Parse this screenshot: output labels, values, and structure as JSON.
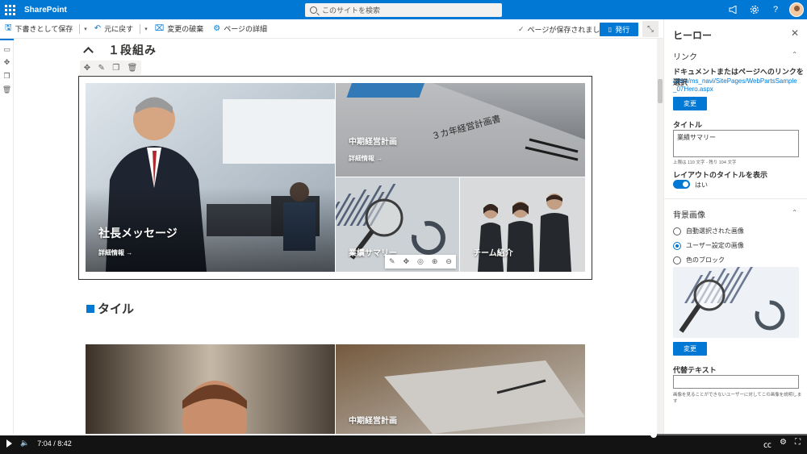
{
  "suite": {
    "brand": "SharePoint",
    "search_placeholder": "このサイトを検索",
    "icons": [
      "megaphone-icon",
      "gear-icon",
      "help-icon"
    ],
    "help_glyph": "?"
  },
  "commandbar": {
    "save_draft": "下書きとして保存",
    "undo": "元に戻す",
    "discard": "変更の破棄",
    "page_details": "ページの詳細",
    "saved_status": "ページが保存されました",
    "publish": "発行"
  },
  "canvas": {
    "section1_title": "１段組み",
    "section2_title": "タイル",
    "hero_tiles": [
      {
        "title": "社長メッセージ",
        "link": "詳細情報 →"
      },
      {
        "title": "中期経営計画",
        "link": "詳細情報 →"
      },
      {
        "title": "業績サマリー",
        "link": ""
      },
      {
        "title": "チーム紹介",
        "link": ""
      }
    ],
    "lower_tiles": [
      {
        "title": ""
      },
      {
        "title": "中期経営計画"
      }
    ]
  },
  "pane": {
    "title": "ヒーロー",
    "link_group": "リンク",
    "link_label": "ドキュメントまたはページへのリンクを選択",
    "link_url": "/sites/ms_navi/SitePages/WebPartsSample_07Hero.aspx",
    "change_button": "変更",
    "title_label": "タイトル",
    "title_value": "業績サマリー",
    "title_hint": "上限は 110 文字 - 残り 104 文字",
    "show_title_label": "レイアウトのタイトルを表示",
    "toggle_state": "はい",
    "bg_group": "背景画像",
    "bg_options": [
      "自動選択された画像",
      "ユーザー設定の画像",
      "色のブロック"
    ],
    "bg_selected": 1,
    "change_button2": "変更",
    "alt_label": "代替テキスト",
    "alt_hint": "画像を見ることができないユーザーに対してこの画像を説明します"
  },
  "video": {
    "current": "7:04",
    "total": "8:42",
    "progress": 0.81
  }
}
